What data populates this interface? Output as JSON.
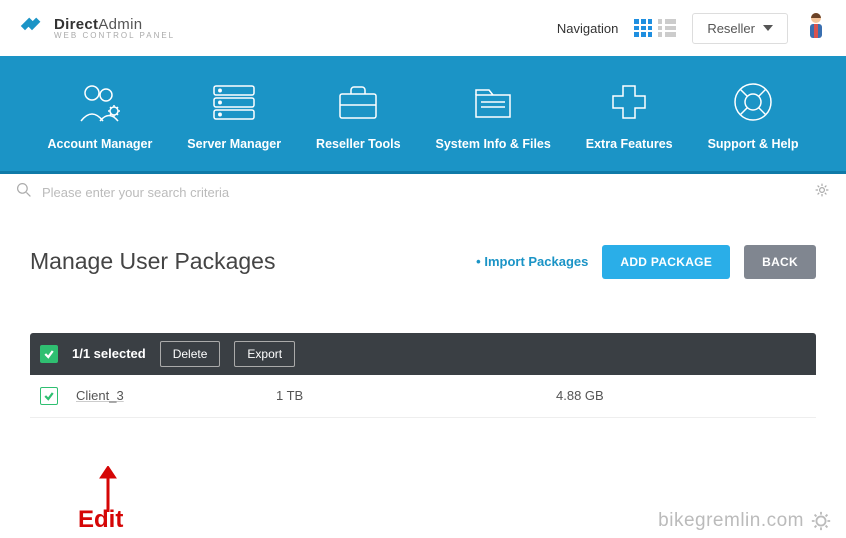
{
  "brand": {
    "title_strong": "Direct",
    "title_light": "Admin",
    "subtitle": "web control panel"
  },
  "header": {
    "navigation_label": "Navigation",
    "role_label": "Reseller"
  },
  "nav": {
    "items": [
      {
        "label": "Account Manager"
      },
      {
        "label": "Server Manager"
      },
      {
        "label": "Reseller Tools"
      },
      {
        "label": "System Info & Files"
      },
      {
        "label": "Extra Features"
      },
      {
        "label": "Support & Help"
      }
    ]
  },
  "search": {
    "placeholder": "Please enter your search criteria"
  },
  "page": {
    "title": "Manage User Packages",
    "import_link": "Import Packages",
    "add_button": "ADD PACKAGE",
    "back_button": "BACK"
  },
  "selection": {
    "text": "1/1 selected",
    "delete": "Delete",
    "export": "Export"
  },
  "rows": [
    {
      "name": "Client_3",
      "disk": "1 TB",
      "bandwidth": "4.88 GB"
    }
  ],
  "annotation": {
    "label": "Edit"
  },
  "watermark": {
    "text": "bikegremlin.com"
  }
}
